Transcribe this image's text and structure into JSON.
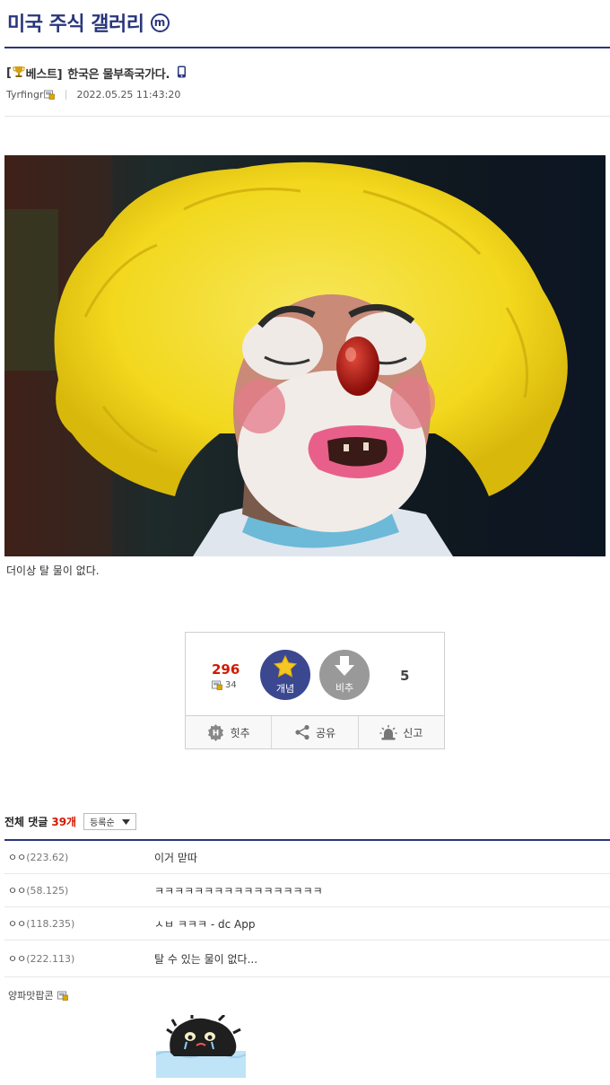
{
  "gallery": {
    "title": "미국 주식 갤러리",
    "badge": "m"
  },
  "post": {
    "prefix_open": "[",
    "prefix_label": "베스트]",
    "title": "한국은 물부족국가다.",
    "author": "Tyrfingr",
    "date": "2022.05.25 11:43:20",
    "body": "더이상 탈 물이 없다."
  },
  "vote": {
    "up_count": "296",
    "fixed_count": "34",
    "up_label": "개념",
    "down_label": "비추",
    "down_count": "5",
    "actions": [
      "힛추",
      "공유",
      "신고"
    ]
  },
  "comments": {
    "header": "전체 댓글",
    "count": "39개",
    "sort": "등록순",
    "rows": [
      {
        "nick": "ㅇㅇ",
        "ip": "(223.62)",
        "text": "이거 맏따"
      },
      {
        "nick": "ㅇㅇ",
        "ip": "(58.125)",
        "text": "ㅋㅋㅋㅋㅋㅋㅋㅋㅋㅋㅋㅋㅋㅋㅋㅋㅋ"
      },
      {
        "nick": "ㅇㅇ",
        "ip": "(118.235)",
        "text": "ㅅㅂ ㅋㅋㅋ - dc App"
      },
      {
        "nick": "ㅇㅇ",
        "ip": "(222.113)",
        "text": "탈 수 있는 물이 없다..."
      }
    ],
    "last_nick": "양파맛팝콘"
  },
  "colors": {
    "brand": "#29367c",
    "accent_red": "#d31900",
    "vote_up": "#3b4890",
    "vote_down": "#999999"
  },
  "icons": [
    "m-badge-icon",
    "trophy-icon",
    "mobile-icon",
    "fixed-user-icon",
    "star-icon",
    "arrow-down-icon",
    "hit-icon",
    "share-icon",
    "report-icon",
    "chevron-down-icon"
  ]
}
